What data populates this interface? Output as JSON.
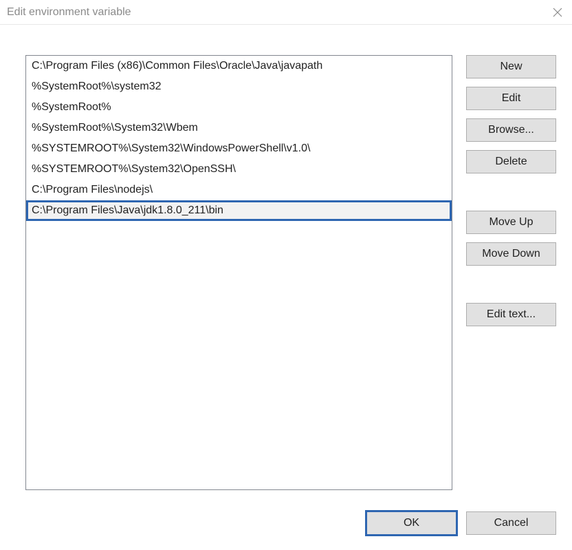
{
  "window": {
    "title": "Edit environment variable"
  },
  "list": {
    "items": [
      {
        "value": "C:\\Program Files (x86)\\Common Files\\Oracle\\Java\\javapath",
        "highlighted": false
      },
      {
        "value": "%SystemRoot%\\system32",
        "highlighted": false
      },
      {
        "value": "%SystemRoot%",
        "highlighted": false
      },
      {
        "value": "%SystemRoot%\\System32\\Wbem",
        "highlighted": false
      },
      {
        "value": "%SYSTEMROOT%\\System32\\WindowsPowerShell\\v1.0\\",
        "highlighted": false
      },
      {
        "value": "%SYSTEMROOT%\\System32\\OpenSSH\\",
        "highlighted": false
      },
      {
        "value": "C:\\Program Files\\nodejs\\",
        "highlighted": false
      },
      {
        "value": "C:\\Program Files\\Java\\jdk1.8.0_211\\bin",
        "highlighted": true
      }
    ]
  },
  "buttons": {
    "new": "New",
    "edit": "Edit",
    "browse": "Browse...",
    "delete": "Delete",
    "move_up": "Move Up",
    "move_down": "Move Down",
    "edit_text": "Edit text...",
    "ok": "OK",
    "cancel": "Cancel"
  }
}
